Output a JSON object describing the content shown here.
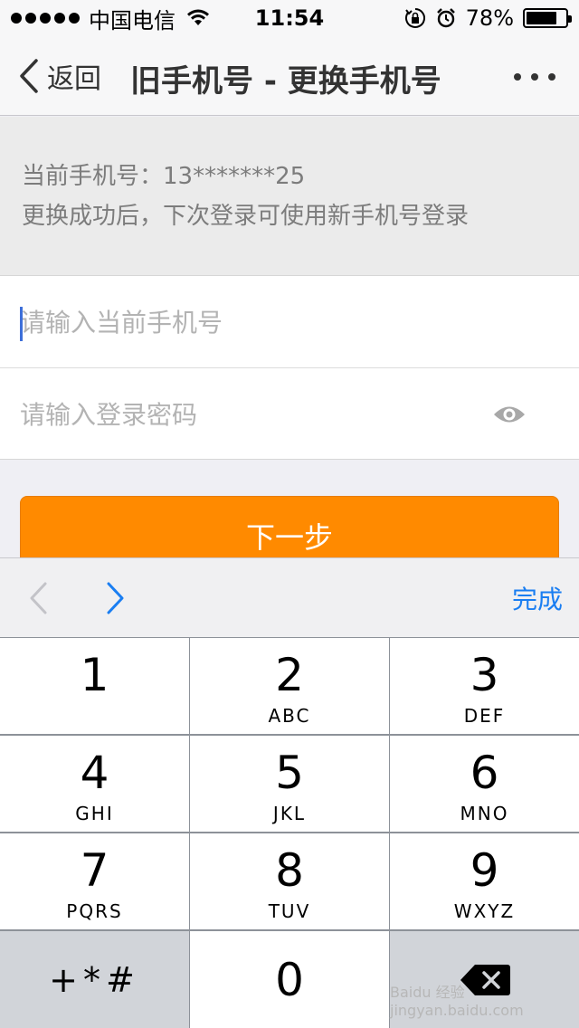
{
  "status_bar": {
    "carrier": "中国电信",
    "time": "11:54",
    "battery_percent": "78%",
    "battery_level": 0.78,
    "icons": [
      "signal-dots",
      "wifi-icon",
      "rotation-lock-icon",
      "alarm-icon",
      "battery-icon"
    ]
  },
  "nav": {
    "back_label": "返回",
    "title": "旧手机号 - 更换手机号",
    "more_icon": "more-dots-icon"
  },
  "info": {
    "current_phone": "当前手机号：13*******25",
    "hint": "更换成功后，下次登录可使用新手机号登录"
  },
  "form": {
    "phone_placeholder": "请输入当前手机号",
    "phone_value": "",
    "password_placeholder": "请输入登录密码",
    "password_value": "",
    "eye_icon": "eye-icon"
  },
  "next_button": "下一步",
  "keyboard_toolbar": {
    "done_label": "完成"
  },
  "keypad": {
    "keys": [
      {
        "num": "1",
        "letters": ""
      },
      {
        "num": "2",
        "letters": "ABC"
      },
      {
        "num": "3",
        "letters": "DEF"
      },
      {
        "num": "4",
        "letters": "GHI"
      },
      {
        "num": "5",
        "letters": "JKL"
      },
      {
        "num": "6",
        "letters": "MNO"
      },
      {
        "num": "7",
        "letters": "PQRS"
      },
      {
        "num": "8",
        "letters": "TUV"
      },
      {
        "num": "9",
        "letters": "WXYZ"
      }
    ],
    "symbols": "+*#",
    "zero": "0"
  },
  "watermark": "Baidu 经验 jingyan.baidu.com",
  "colors": {
    "accent_orange": "#ff8a00",
    "link_blue": "#1a7ef2",
    "caret_blue": "#3d6fd9"
  }
}
